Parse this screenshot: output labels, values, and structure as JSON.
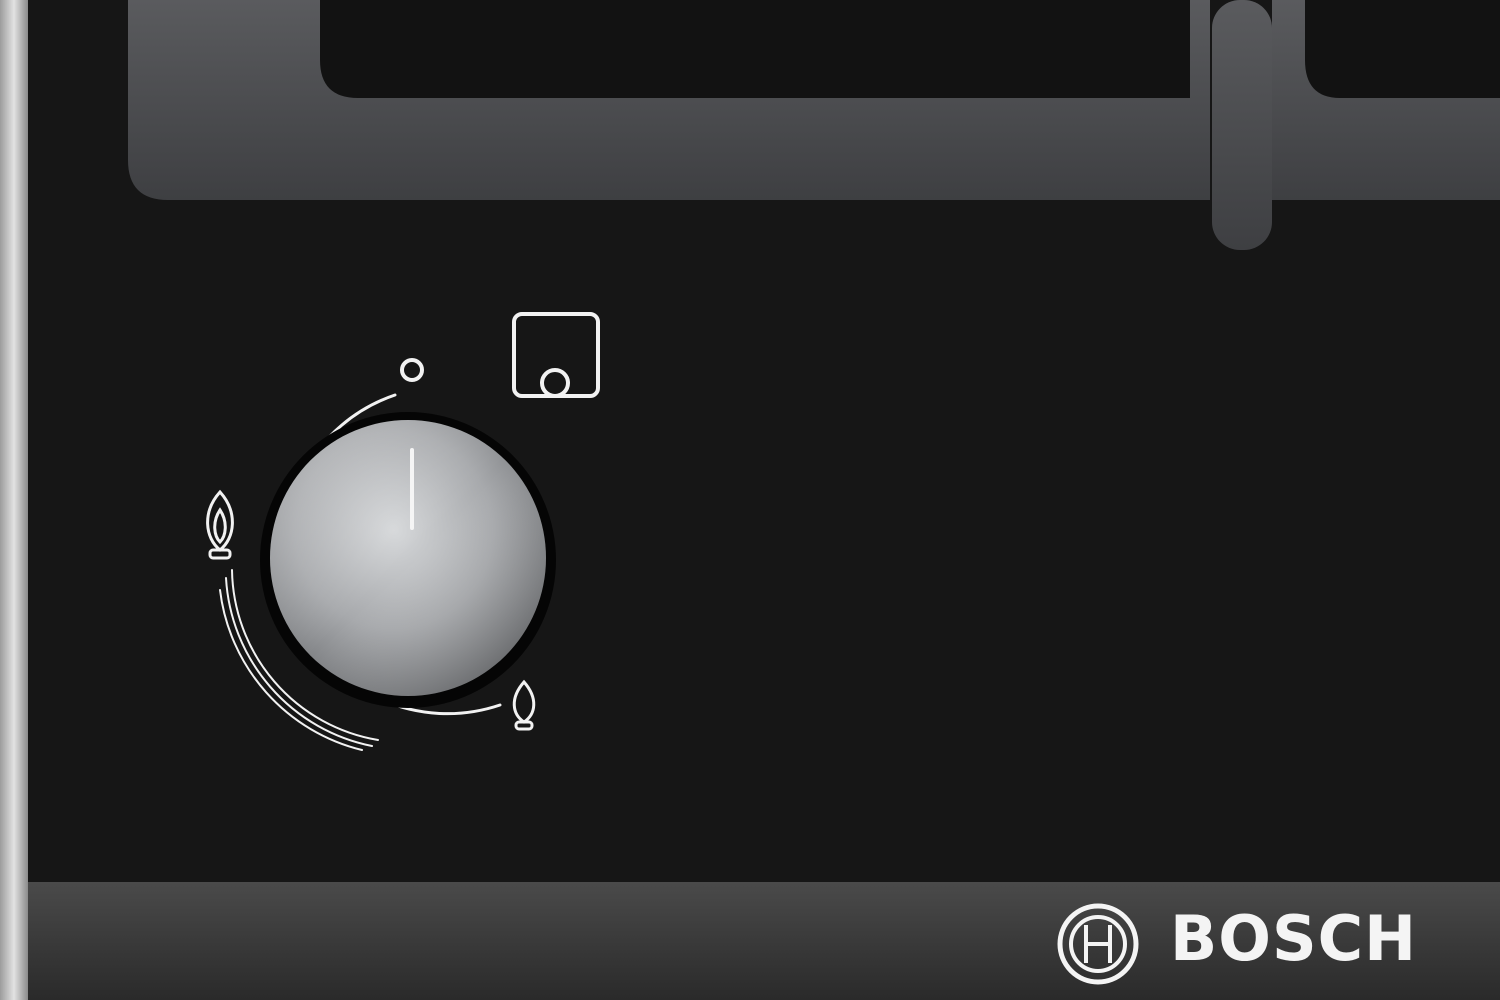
{
  "brand": {
    "name": "BOSCH",
    "logo": "bosch-armature-logo"
  },
  "control_knob": {
    "position_shown": "off",
    "indicator": "vertical-line-up"
  },
  "dial_markings": {
    "off_symbol": "circle-small-icon",
    "max_flame_symbol": "large-flame-icon",
    "min_flame_symbol": "small-flame-icon",
    "burner_position_symbol": "burner-position-icon"
  },
  "colors": {
    "glass": "#161616",
    "grate": "#4a4b4e",
    "knob": "#a9abae",
    "markings": "#f2f2f2",
    "trim": "#3c3c3c",
    "frame": "#c8c8c8"
  }
}
